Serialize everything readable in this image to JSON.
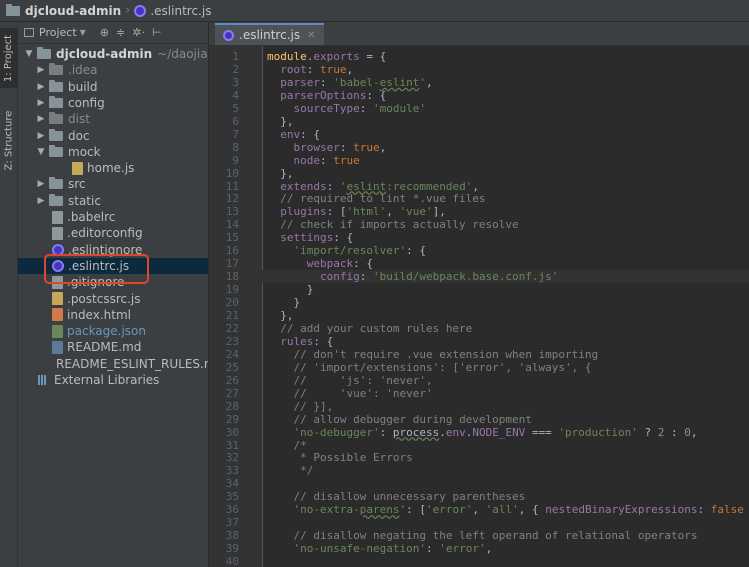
{
  "breadcrumb": {
    "project": "djcloud-admin",
    "file": ".eslintrc.js"
  },
  "sidebar_tabs": {
    "project": "1: Project",
    "structure": "Z: Structure"
  },
  "project_panel": {
    "title": "Project",
    "tools": [
      "⊕",
      "≑",
      "✲·",
      "⊢"
    ],
    "root": {
      "name": "djcloud-admin",
      "path": "~/daojia/djclo"
    },
    "items": [
      {
        "label": ".idea",
        "kind": "folder",
        "dim": true,
        "expanded": false
      },
      {
        "label": "build",
        "kind": "folder",
        "dim": false,
        "expanded": false
      },
      {
        "label": "config",
        "kind": "folder",
        "dim": false,
        "expanded": false
      },
      {
        "label": "dist",
        "kind": "folder",
        "dim": true,
        "expanded": false
      },
      {
        "label": "doc",
        "kind": "folder",
        "dim": false,
        "expanded": false
      },
      {
        "label": "mock",
        "kind": "folder",
        "dim": false,
        "expanded": true
      },
      {
        "label": "home.js",
        "kind": "js",
        "indent": 2
      },
      {
        "label": "src",
        "kind": "folder",
        "dim": false,
        "expanded": false
      },
      {
        "label": "static",
        "kind": "folder",
        "dim": false,
        "expanded": false
      },
      {
        "label": ".babelrc",
        "kind": "cfg"
      },
      {
        "label": ".editorconfig",
        "kind": "cfg"
      },
      {
        "label": ".eslintignore",
        "kind": "eslint"
      },
      {
        "label": ".eslintrc.js",
        "kind": "eslint",
        "selected": true
      },
      {
        "label": ".gitignore",
        "kind": "cfg"
      },
      {
        "label": ".postcssrc.js",
        "kind": "js"
      },
      {
        "label": "index.html",
        "kind": "html"
      },
      {
        "label": "package.json",
        "kind": "json",
        "blue": true
      },
      {
        "label": "README.md",
        "kind": "md"
      },
      {
        "label": "README_ESLINT_RULES.r",
        "kind": "md"
      }
    ],
    "external": "External Libraries"
  },
  "editor": {
    "tab_label": ".eslintrc.js",
    "current_line": 18,
    "lines": [
      "<span class=\"fn\">module</span>.<span class=\"prop\">exports</span> = {",
      "  <span class=\"prop\">root</span>: <span class=\"kw\">true</span>,",
      "  <span class=\"prop\">parser</span>: <span class=\"str\">'babel-<span class=\"ul\">eslint</span>'</span>,",
      "  <span class=\"prop\">parserOptions</span>: {",
      "    <span class=\"prop\">sourceType</span>: <span class=\"str\">'module'</span>",
      "  },",
      "  <span class=\"prop\">env</span>: {",
      "    <span class=\"prop\">browser</span>: <span class=\"kw\">true</span>,",
      "    <span class=\"prop\">node</span>: <span class=\"kw\">true</span>",
      "  },",
      "  <span class=\"prop\">extends</span>: <span class=\"str\">'<span class=\"ul\">eslint</span>:recommended'</span>,",
      "  <span class=\"cmt\">// required to lint *.vue files</span>",
      "  <span class=\"prop\">plugins</span>: [<span class=\"str\">'html'</span>, <span class=\"str\">'vue'</span>],",
      "  <span class=\"cmt\">// check if imports actually resolve</span>",
      "  <span class=\"prop\">settings</span>: {",
      "    <span class=\"str\">'import/resolver'</span>: {",
      "      <span class=\"prop\">webpack</span>: {",
      "        <span class=\"prop\">config</span>: <span class=\"str\">'build/webpack.base.conf.js'</span>",
      "      }",
      "    }",
      "  },",
      "  <span class=\"cmt\">// add your custom rules here</span>",
      "  <span class=\"prop\">rules</span>: {",
      "    <span class=\"cmt\">// don't require .vue extension when importing</span>",
      "    <span class=\"cmt\">// 'import/extensions': ['error', 'always', {</span>",
      "    <span class=\"cmt\">//     'js': 'never',</span>",
      "    <span class=\"cmt\">//     'vue': 'never'</span>",
      "    <span class=\"cmt\">// }],</span>",
      "    <span class=\"cmt\">// allow debugger during development</span>",
      "    <span class=\"str\">'no-debugger'</span>: <span class=\"ul\">process</span>.<span class=\"prop\">env</span>.<span class=\"prop\">NODE_ENV</span> === <span class=\"str\">'production'</span> ? <span class=\"num\">2</span> : <span class=\"num\">0</span>,",
      "    <span class=\"cmt\">/*</span>",
      "    <span class=\"cmt\"> * Possible Errors</span>",
      "    <span class=\"cmt\"> */</span>",
      "",
      "    <span class=\"cmt\">// disallow unnecessary parentheses</span>",
      "    <span class=\"str\">'no-extra-<span class=\"ul\">parens</span>'</span>: [<span class=\"str\">'error'</span>, <span class=\"str\">'all'</span>, { <span class=\"prop\">nestedBinaryExpressions</span>: <span class=\"kw\">false</span> }],",
      "",
      "    <span class=\"cmt\">// disallow negating the left operand of relational operators</span>",
      "    <span class=\"str\">'no-unsafe-negation'</span>: <span class=\"str\">'error'</span>,",
      ""
    ]
  }
}
